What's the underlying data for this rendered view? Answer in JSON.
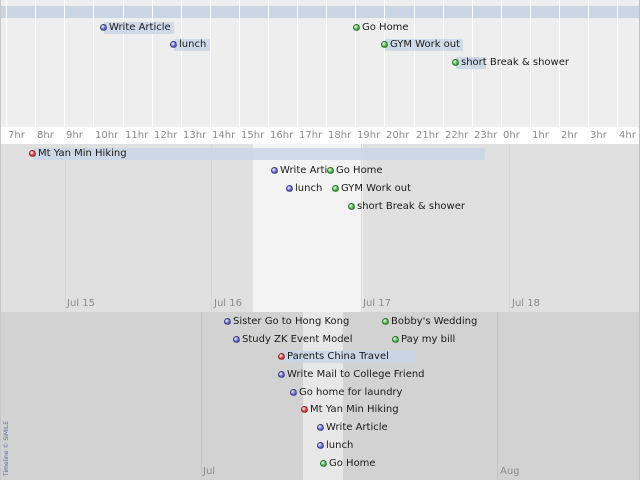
{
  "hour_band": {
    "hour_labels": [
      "hr",
      "7hr",
      "8hr",
      "9hr",
      "10hr",
      "11hr",
      "12hr",
      "13hr",
      "14hr",
      "15hr",
      "16hr",
      "17hr",
      "18hr",
      "19hr",
      "20hr",
      "21hr",
      "22hr",
      "23hr",
      "0hr",
      "1hr",
      "2hr",
      "3hr",
      "4hr"
    ],
    "events": [
      {
        "title": "Write Article",
        "color": "#5b5fc7"
      },
      {
        "title": "lunch",
        "color": "#5b5fc7"
      },
      {
        "title": "Go Home",
        "color": "#3fb33f"
      },
      {
        "title": "GYM Work out",
        "color": "#3fb33f"
      },
      {
        "title": "short Break & shower",
        "color": "#3fb33f"
      }
    ]
  },
  "day_band": {
    "date_labels": [
      "Jul 15",
      "Jul 16",
      "Jul 17",
      "Jul 18"
    ],
    "events": [
      {
        "title": "Mt Yan Min Hiking",
        "color": "#d23a3a"
      },
      {
        "title": "Write Article",
        "color": "#5b5fc7"
      },
      {
        "title": "Go Home",
        "color": "#3fb33f"
      },
      {
        "title": "lunch",
        "color": "#5b5fc7"
      },
      {
        "title": "GYM Work out",
        "color": "#3fb33f"
      },
      {
        "title": "short Break & shower",
        "color": "#3fb33f"
      }
    ]
  },
  "month_band": {
    "date_labels": [
      "Jul",
      "Aug"
    ],
    "events": [
      {
        "title": "Sister Go to Hong Kong",
        "color": "#5b5fc7"
      },
      {
        "title": "Bobby's Wedding",
        "color": "#3fb33f"
      },
      {
        "title": "Study ZK Event Model",
        "color": "#5b5fc7"
      },
      {
        "title": "Pay my bill",
        "color": "#3fb33f"
      },
      {
        "title": "Parents China Travel",
        "color": "#d23a3a"
      },
      {
        "title": "Write Mail to College Friend",
        "color": "#5b5fc7"
      },
      {
        "title": "Go home for laundry",
        "color": "#5b5fc7"
      },
      {
        "title": "Mt Yan Min Hiking",
        "color": "#d23a3a"
      },
      {
        "title": "Write Article",
        "color": "#5b5fc7"
      },
      {
        "title": "lunch",
        "color": "#5b5fc7"
      },
      {
        "title": "Go Home",
        "color": "#3fb33f"
      }
    ],
    "copyright": "Timeline © SIMILE"
  }
}
